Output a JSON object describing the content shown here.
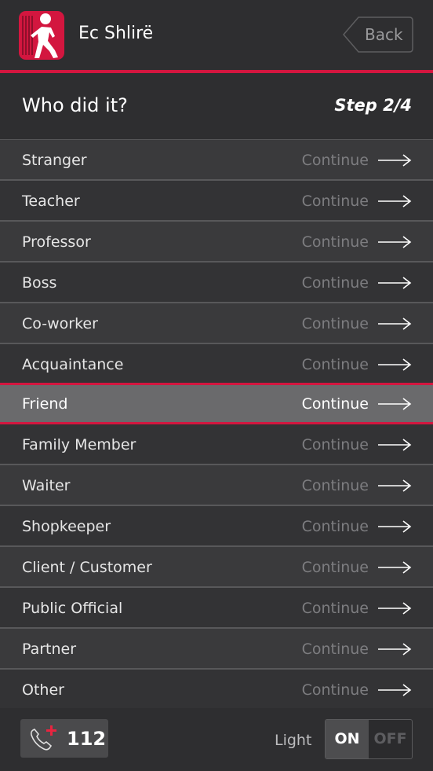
{
  "header": {
    "app_title": "Ec Shlirë",
    "back_label": "Back",
    "accent_color": "#d3163f"
  },
  "step": {
    "question": "Who did it?",
    "progress": "Step 2/4"
  },
  "options": [
    {
      "label": "Stranger",
      "action": "Continue",
      "selected": false
    },
    {
      "label": "Teacher",
      "action": "Continue",
      "selected": false
    },
    {
      "label": "Professor",
      "action": "Continue",
      "selected": false
    },
    {
      "label": "Boss",
      "action": "Continue",
      "selected": false
    },
    {
      "label": "Co-worker",
      "action": "Continue",
      "selected": false
    },
    {
      "label": "Acquaintance",
      "action": "Continue",
      "selected": false
    },
    {
      "label": "Friend",
      "action": "Continue",
      "selected": true
    },
    {
      "label": "Family Member",
      "action": "Continue",
      "selected": false
    },
    {
      "label": "Waiter",
      "action": "Continue",
      "selected": false
    },
    {
      "label": "Shopkeeper",
      "action": "Continue",
      "selected": false
    },
    {
      "label": "Client / Customer",
      "action": "Continue",
      "selected": false
    },
    {
      "label": "Public Official",
      "action": "Continue",
      "selected": false
    },
    {
      "label": "Partner",
      "action": "Continue",
      "selected": false
    },
    {
      "label": "Other",
      "action": "Continue",
      "selected": false
    }
  ],
  "footer": {
    "emergency_number": "112",
    "emergency_icon": "phone-plus-icon",
    "light_label": "Light",
    "toggle_on": "ON",
    "toggle_off": "OFF",
    "light_state": "on"
  }
}
